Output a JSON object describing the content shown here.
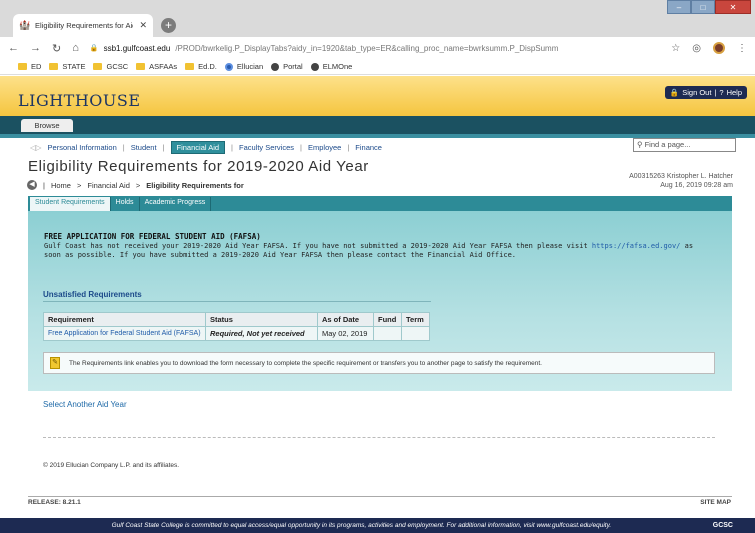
{
  "browser": {
    "tab_title": "Eligibility Requirements for Aid Y",
    "tab_favicon": "lighthouse-icon",
    "url_domain": "ssb1.gulfcoast.edu",
    "url_path": "/PROD/bwrkelig.P_DisplayTabs?aidy_in=1920&tab_type=ER&calling_proc_name=bwrksumm.P_DispSumm",
    "bookmarks": [
      "ED",
      "STATE",
      "GCSC",
      "ASFAAs",
      "Ed.D.",
      "Ellucian",
      "Portal",
      "ELMOne"
    ]
  },
  "banner": {
    "logo": "LIGHTHOUSE",
    "sign_out": "Sign Out",
    "help": "Help"
  },
  "menubar": {
    "browse": "Browse"
  },
  "topnav": {
    "items": [
      "Personal Information",
      "Student",
      "Financial Aid",
      "Faculty Services",
      "Employee",
      "Finance"
    ],
    "active": "Financial Aid",
    "find_placeholder": "Find a page..."
  },
  "page": {
    "title": "Eligibility Requirements for 2019-2020 Aid Year",
    "user_line1": "A00315263 Kristopher L. Hatcher",
    "user_line2": "Aug 16, 2019 09:28 am",
    "breadcrumb_home": "Home",
    "breadcrumb_fa": "Financial Aid",
    "breadcrumb_current": "Eligibility Requirements for"
  },
  "subtabs": [
    "Student Requirements",
    "Holds",
    "Academic Progress"
  ],
  "fafsa": {
    "title": "FREE APPLICATION FOR FEDERAL STUDENT AID (FAFSA)",
    "msg_before": "Gulf Coast has not received your 2019-2020 Aid Year FAFSA. If you have not submitted a 2019-2020 Aid Year FAFSA then please visit ",
    "link": "https://fafsa.ed.gov/",
    "msg_after": " as soon as possible. If you have submitted a 2019-2020 Aid Year FAFSA then please contact the Financial Aid Office."
  },
  "requirements": {
    "heading": "Unsatisfied Requirements",
    "columns": [
      "Requirement",
      "Status",
      "As of Date",
      "Fund",
      "Term"
    ],
    "rows": [
      {
        "requirement": "Free Application for Federal Student Aid (FAFSA)",
        "status": "Required, Not yet received",
        "date": "May 02, 2019",
        "fund": "",
        "term": ""
      }
    ],
    "note": "The Requirements link enables you to download the form necessary to complete the specific requirement or transfers you to another page to satisfy the requirement."
  },
  "select_aid_year": "Select Another Aid Year",
  "copyright": "© 2019 Ellucian Company L.P. and its affiliates.",
  "footer": {
    "release": "RELEASE: 8.21.1",
    "site_map": "SITE MAP",
    "bottom_text": "Gulf Coast State College is committed to equal access/equal opportunity in its programs, activities and employment. For additional information, visit www.gulfcoast.edu/equity.",
    "bottom_right": "GCSC"
  },
  "colors": {
    "accent": "#2d8b97",
    "banner": "#f5c53f",
    "navy": "#1d2a52"
  }
}
